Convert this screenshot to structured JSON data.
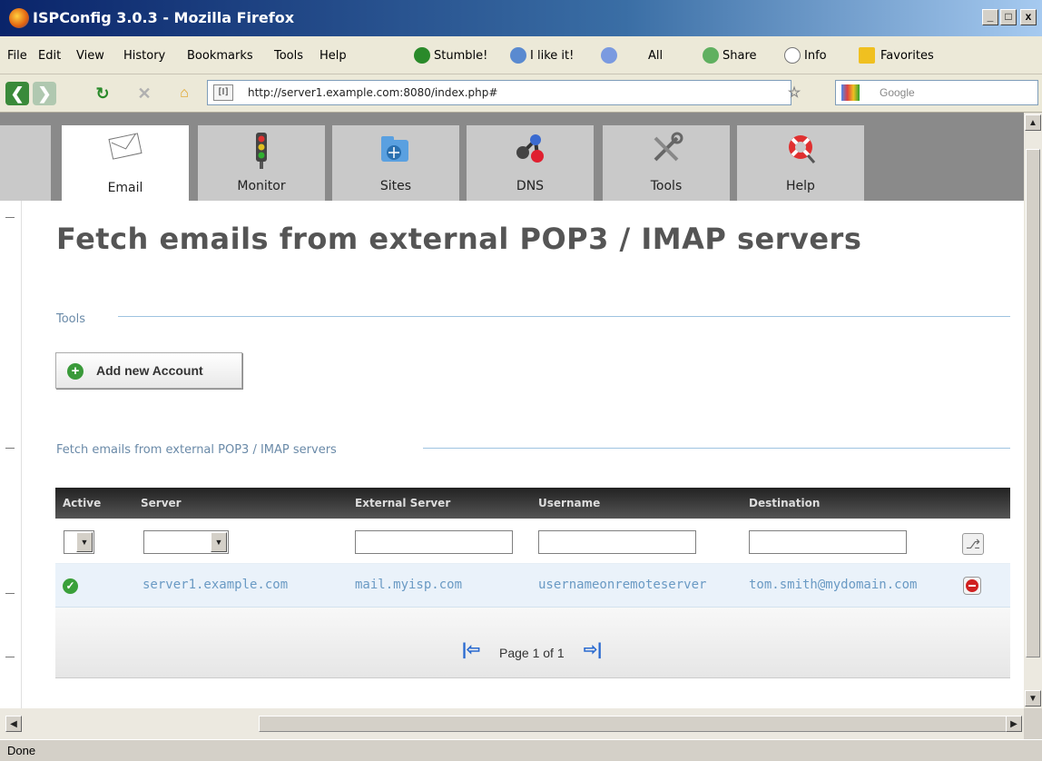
{
  "window": {
    "title": "ISPConfig 3.0.3 - Mozilla Firefox",
    "controls": [
      "_",
      "□",
      "x"
    ]
  },
  "menu": {
    "items": [
      "File",
      "Edit",
      "View",
      "History",
      "Bookmarks",
      "Tools",
      "Help"
    ],
    "toolbar": {
      "stumble": "Stumble!",
      "ilike": "I like it!",
      "all": "All",
      "share": "Share",
      "info": "Info",
      "favorites": "Favorites"
    }
  },
  "nav": {
    "url": "http://server1.example.com:8080/index.php#",
    "search_placeholder": "Google"
  },
  "tabs": [
    {
      "label": "Email",
      "icon": "envelope-icon",
      "active": true
    },
    {
      "label": "Monitor",
      "icon": "traffic-light-icon",
      "active": false
    },
    {
      "label": "Sites",
      "icon": "folder-globe-icon",
      "active": false
    },
    {
      "label": "DNS",
      "icon": "network-nodes-icon",
      "active": false
    },
    {
      "label": "Tools",
      "icon": "wrench-screwdriver-icon",
      "active": false
    },
    {
      "label": "Help",
      "icon": "lifebuoy-icon",
      "active": false
    }
  ],
  "page": {
    "title": "Fetch emails from external POP3 / IMAP servers",
    "tools_section": "Tools",
    "add_button": "Add new Account",
    "list_section": "Fetch emails from external POP3 / IMAP servers"
  },
  "table": {
    "headers": [
      "Active",
      "Server",
      "External Server",
      "Username",
      "Destination"
    ],
    "rows": [
      {
        "active": true,
        "server": "server1.example.com",
        "external_server": "mail.myisp.com",
        "username": "usernameonremoteserver",
        "destination": "tom.smith@mydomain.com"
      }
    ],
    "pager": "Page 1 of 1"
  },
  "status": "Done",
  "colors": {
    "link": "#6a9ac4",
    "section": "#6a8aa8",
    "header_bg": "#333333",
    "active_green": "#3aa03a",
    "delete_red": "#d02020"
  }
}
